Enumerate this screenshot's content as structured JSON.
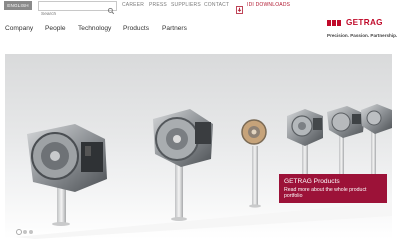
{
  "header": {
    "language_label": "ENGLISH",
    "search_placeholder": "Search",
    "links": [
      "CAREER",
      "PRESS",
      "SUPPLIERS",
      "CONTACT"
    ],
    "downloads_label": "IDI DOWNLOADS"
  },
  "nav": {
    "items": [
      "Company",
      "People",
      "Technology",
      "Products",
      "Partners"
    ]
  },
  "brand": {
    "name": "GETRAG",
    "tagline": "Precision. Passion. Partnership.",
    "color": "#c00a2a"
  },
  "hero": {
    "title": "GETRAG Products",
    "subtitle": "Read more about the whole product portfolio",
    "overlay_color": "#9c1238",
    "slides": 3,
    "active_slide": 1
  },
  "icons": {
    "search": "search-icon",
    "downloads": "download-icon"
  }
}
